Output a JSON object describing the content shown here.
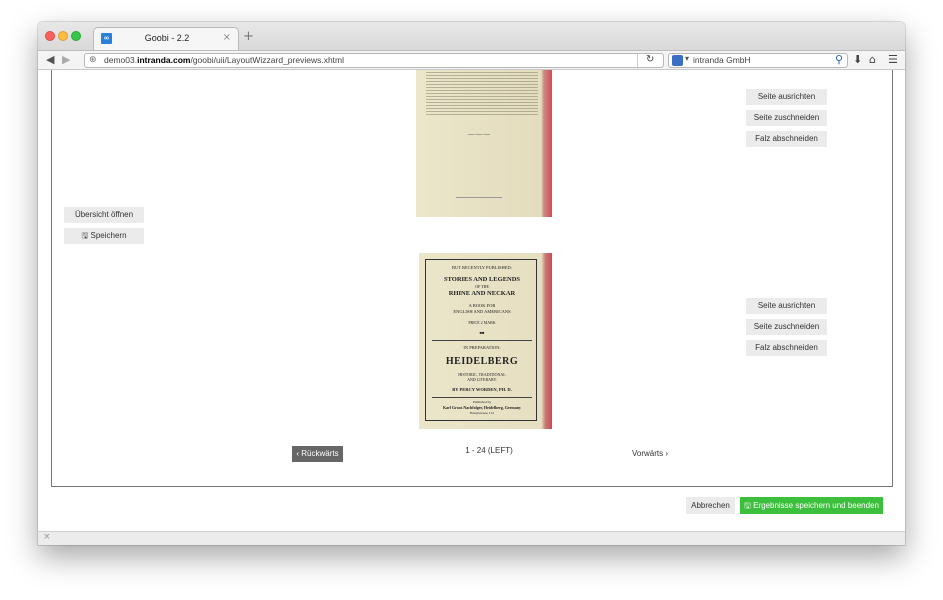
{
  "browser": {
    "tab_title": "Goobi - 2.2",
    "tab_close": "×",
    "new_tab": "+",
    "url_host_prefix": "demo03.",
    "url_host_domain": "intranda.com",
    "url_path": "/goobi/uii/LayoutWizzard_previews.xhtml",
    "search_text": "intranda GmbH",
    "icons": {
      "back": "back-arrow-icon",
      "forward": "forward-arrow-icon",
      "reload": "reload-icon",
      "search": "magnifier-icon",
      "download": "download-icon",
      "home": "home-icon",
      "menu": "hamburger-menu-icon"
    }
  },
  "left_panel": {
    "overview_label": "Übersicht öffnen",
    "save_label": "Speichern"
  },
  "page_actions_top": {
    "align_label": "Seite ausrichten",
    "crop_label": "Seite zuschneiden",
    "fold_label": "Falz abschneiden"
  },
  "page_actions_bottom": {
    "align_label": "Seite ausrichten",
    "crop_label": "Seite zuschneiden",
    "fold_label": "Falz abschneiden"
  },
  "scan": {
    "line1": "BUT RECENTLY PUBLISHED:",
    "line2": "STORIES AND LEGENDS",
    "line3": "OF THE",
    "line4": "RHINE AND NECKAR",
    "line5": "A BOOK FOR",
    "line6": "ENGLISH AND AMERICANS",
    "line7": "PRICE 2 MARK",
    "line8": "■■",
    "line9": "IN PREPARATION:",
    "line10": "HEIDELBERG",
    "line11": "HISTORIC, TRADITIONAL",
    "line12": "AND LITERARY.",
    "line13": "BY PERCY WORDEN, PH. D.",
    "line14": "Published by",
    "line15": "Karl Groos Nachfolger, Heidelberg, Germany",
    "line16": "Hauptstrasse 114",
    "top_ornament": "—·—·—"
  },
  "pager": {
    "prev_label": "Rückwärts",
    "info": "1 - 24 (LEFT)",
    "next_label": "Vorwärts"
  },
  "footer": {
    "cancel_label": "Abbrechen",
    "save_finish_label": "Ergebnisse speichern und beenden"
  },
  "colors": {
    "save_green": "#3cbf3c",
    "pager_grey": "#666666",
    "button_grey": "#ebebeb",
    "accent_red_edge": "#d54451"
  }
}
